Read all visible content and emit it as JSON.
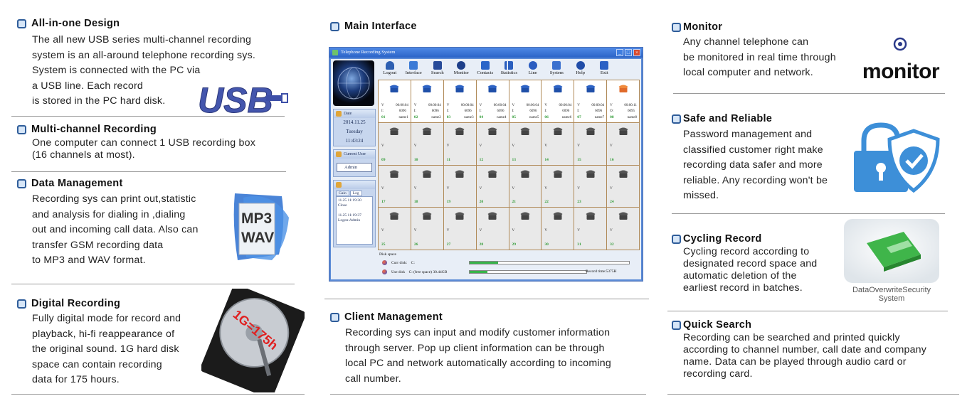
{
  "col1": {
    "all_in_one": {
      "title": "All-in-one Design",
      "lines": [
        "The all new USB series multi-channel recording",
        "system is an all-around telephone recording sys.",
        "System is connected with the PC via",
        "a USB line. Each record",
        "is stored in the PC hard disk."
      ]
    },
    "usb_logo_text": "USB",
    "multichannel": {
      "title": "Multi-channel Recording",
      "lines": [
        "One computer can  connect 1 USB recording box",
        "(16 channels at most)."
      ]
    },
    "data_mgmt": {
      "title": "Data Management",
      "lines": [
        "Recording sys can print out,statistic",
        "and analysis for dialing in ,dialing",
        "out and incoming call data. Also can",
        "transfer GSM recording data",
        "to MP3 and WAV format."
      ]
    },
    "mp3_label": "MP3",
    "wav_label": "WAV",
    "digital": {
      "title": "Digital Recording",
      "lines": [
        "Fully digital mode for record and",
        "playback, hi-fi reappearance of",
        "the original sound.  1G hard disk",
        "space can contain recording",
        "data for 175 hours."
      ]
    },
    "hdd_label": "1G=175h"
  },
  "col2": {
    "main_interface": {
      "title": "Main Interface"
    },
    "window": {
      "title": "Telephone Recording System",
      "toolbar": [
        "Logout",
        "Interface",
        "Search",
        "Monitor",
        "Contacts",
        "Statistics",
        "Line",
        "System",
        "Help",
        "Exit"
      ],
      "date_label": "Date",
      "date": "2014.11.25",
      "weekday": "Tuesday",
      "time": "11:43:24",
      "current_user_label": "Current User",
      "user": "Admin",
      "tabs": [
        "Gain",
        "Log"
      ],
      "log_lines": [
        "11.25 11:19:30",
        "Close",
        "",
        "11.25 11:19:37",
        "Logon:Admin"
      ],
      "channels_row1": [
        {
          "num": "01",
          "prefix": "V",
          "time": "00:00:04",
          "i": "I:",
          "code": "6096",
          "name": "name1"
        },
        {
          "num": "02",
          "prefix": "V",
          "time": "00:00:04",
          "i": "I:",
          "code": "6096",
          "name": "name2"
        },
        {
          "num": "03",
          "prefix": "V",
          "time": "00:00:04",
          "i": "I:",
          "code": "6096",
          "name": "name3"
        },
        {
          "num": "04",
          "prefix": "V",
          "time": "00:00:04",
          "i": "I:",
          "code": "6096",
          "name": "name4"
        },
        {
          "num": "05",
          "prefix": "V",
          "time": "00:00:04",
          "i": "I:",
          "code": "6096",
          "name": "name5"
        },
        {
          "num": "06",
          "prefix": "V",
          "time": "00:00:04",
          "i": "I:",
          "code": "6096",
          "name": "name6"
        },
        {
          "num": "07",
          "prefix": "V",
          "time": "00:00:04",
          "i": "I:",
          "code": "6096",
          "name": "name7"
        },
        {
          "num": "08",
          "prefix": "V",
          "time": "00:00:11",
          "i": "O:",
          "code": "6095",
          "name": "name8"
        }
      ],
      "idle_channels": [
        "09",
        "10",
        "11",
        "12",
        "13",
        "14",
        "15",
        "16",
        "17",
        "18",
        "19",
        "20",
        "21",
        "22",
        "23",
        "24",
        "25",
        "26",
        "27",
        "28",
        "29",
        "30",
        "31",
        "32"
      ],
      "idle_prefix": "V",
      "disk_title": "Disk space",
      "curr_disk_label": "Curr disk:",
      "curr_disk_value": "C:",
      "use_disk_label": "Use disk",
      "use_disk_value": "C: (free space)  30.44GB",
      "record_time": "Record time:5375H",
      "curr_disk_fill": 0.18,
      "use_disk_fill": 0.15
    },
    "client_mgmt": {
      "title": "Client Management",
      "lines": [
        "Recording sys can input and modify customer information",
        "through server. Pop up client information can be through",
        "local PC and network automatically according to incoming",
        "call number."
      ]
    }
  },
  "col3": {
    "monitor": {
      "title": "Monitor",
      "lines": [
        "Any channel telephone can",
        "be monitored in real time through",
        "local computer and network."
      ]
    },
    "monitor_logo": "monitor",
    "safe": {
      "title": "Safe and Reliable",
      "lines": [
        "Password management and",
        "classified customer right make",
        "recording data safer and more",
        "reliable. Any recording won't be",
        "missed."
      ]
    },
    "cycling": {
      "title": "Cycling Record",
      "lines": [
        "Cycling record according to",
        "designated record space and",
        "automatic deletion of the",
        "earliest record in batches."
      ]
    },
    "overwrite_label_1": "DataOverwriteSecurity",
    "overwrite_label_2": "System",
    "quick": {
      "title": "Quick Search",
      "lines": [
        "Recording can be searched and printed quickly",
        "according to channel number, call date and company",
        "name. Data can be played through audio card or",
        "recording card."
      ]
    }
  },
  "colors": {
    "bullet_border": "#2f5d9a",
    "usb_blue": "#3d4fa8",
    "green_num": "#2e9a34"
  }
}
